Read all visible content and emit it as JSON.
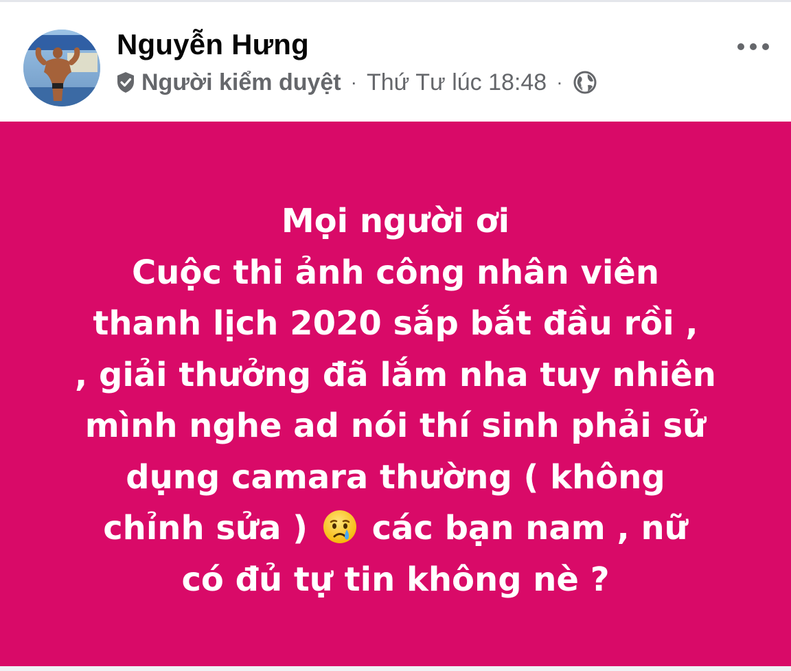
{
  "post": {
    "author_name": "Nguyễn Hưng",
    "author_role": "Người kiểm duyệt",
    "separator": "·",
    "timestamp": "Thứ Tư lúc 18:48",
    "audience_icon": "globe-icon",
    "role_icon": "shield-check-icon",
    "more_icon": "more-options-icon",
    "background_color": "#d90a68",
    "text_color": "#ffffff",
    "lines": [
      "Mọi người ơi",
      "Cuộc thi ảnh công nhân viên",
      "thanh lịch 2020 sắp bắt đầu rồi ,",
      ", giải thưởng đã lắm nha tuy nhiên",
      "mình nghe ad nói thí sinh phải sử",
      "dụng camara thường ( không"
    ],
    "line7_before_emoji": "chỉnh sửa )",
    "emoji_name": "crying-face-emoji",
    "line7_after_emoji": "các bạn nam , nữ",
    "line8": "có đủ tự tin không nè ?"
  }
}
